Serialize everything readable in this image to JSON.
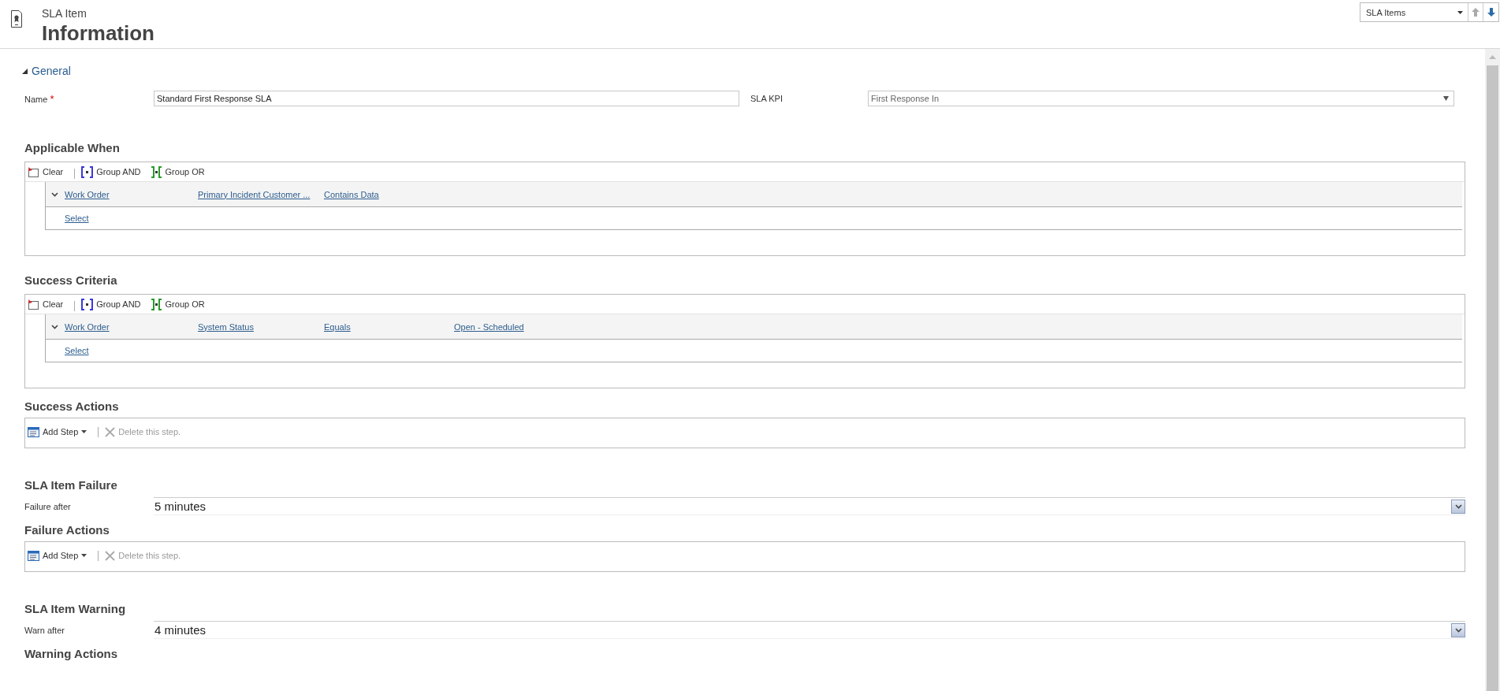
{
  "header": {
    "entity": "SLA Item",
    "title": "Information"
  },
  "record_nav": {
    "selector": "SLA Items"
  },
  "section": {
    "title": "General",
    "expanded": true
  },
  "name_field": {
    "label": "Name",
    "required_mark": "*",
    "value": "Standard First Response SLA"
  },
  "kpi_field": {
    "label": "SLA KPI",
    "value": "First Response In"
  },
  "condition_groups": [
    {
      "title": "Applicable When",
      "toolbar": [
        {
          "kind": "clear",
          "label": "Clear"
        },
        {
          "kind": "and",
          "label": "Group AND"
        },
        {
          "kind": "or",
          "label": "Group OR"
        }
      ],
      "conditions": [
        {
          "expanded": true,
          "cells": [
            "Work Order",
            "Primary Incident Customer ...",
            "Contains Data"
          ]
        }
      ],
      "add_link": "Select"
    },
    {
      "title": "Success Criteria",
      "toolbar": [
        {
          "kind": "clear",
          "label": "Clear"
        },
        {
          "kind": "and",
          "label": "Group AND"
        },
        {
          "kind": "or",
          "label": "Group OR"
        }
      ],
      "conditions": [
        {
          "expanded": true,
          "cells": [
            "Work Order",
            "System Status",
            "Equals",
            "Open - Scheduled"
          ]
        }
      ],
      "add_link": "Select"
    }
  ],
  "success_actions": {
    "title": "Success Actions",
    "add_step": "Add Step",
    "delete_step": "Delete this step.",
    "delete_disabled": true
  },
  "failure": {
    "title": "SLA Item Failure",
    "field_label": "Failure after",
    "value": "5 minutes",
    "actions": {
      "title": "Failure Actions",
      "add_step": "Add Step",
      "delete_step": "Delete this step.",
      "delete_disabled": true
    }
  },
  "warning": {
    "title": "SLA Item Warning",
    "field_label": "Warn after",
    "value": "4 minutes",
    "actions_title": "Warning Actions"
  }
}
